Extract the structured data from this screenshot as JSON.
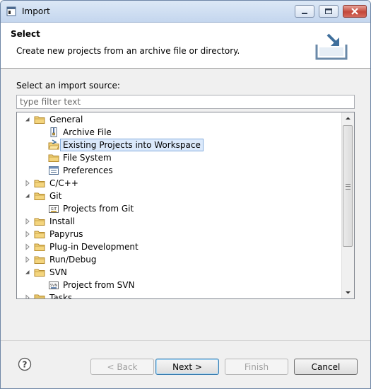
{
  "window": {
    "title": "Import"
  },
  "banner": {
    "title": "Select",
    "description": "Create new projects from an archive file or directory."
  },
  "source": {
    "label": "Select an import source:",
    "filter_placeholder": "type filter text"
  },
  "tree": [
    {
      "label": "General",
      "expanded": true,
      "icon": "folder-icon",
      "depth": 0
    },
    {
      "label": "Archive File",
      "icon": "archive-file-icon",
      "depth": 1
    },
    {
      "label": "Existing Projects into Workspace",
      "icon": "project-folder-icon",
      "depth": 1,
      "selected": true
    },
    {
      "label": "File System",
      "icon": "folder-icon",
      "depth": 1
    },
    {
      "label": "Preferences",
      "icon": "preferences-icon",
      "depth": 1
    },
    {
      "label": "C/C++",
      "expanded": false,
      "icon": "folder-icon",
      "depth": 0
    },
    {
      "label": "Git",
      "expanded": true,
      "icon": "folder-icon",
      "depth": 0
    },
    {
      "label": "Projects from Git",
      "icon": "git-icon",
      "depth": 1
    },
    {
      "label": "Install",
      "expanded": false,
      "icon": "folder-icon",
      "depth": 0
    },
    {
      "label": "Papyrus",
      "expanded": false,
      "icon": "folder-icon",
      "depth": 0
    },
    {
      "label": "Plug-in Development",
      "expanded": false,
      "icon": "folder-icon",
      "depth": 0
    },
    {
      "label": "Run/Debug",
      "expanded": false,
      "icon": "folder-icon",
      "depth": 0
    },
    {
      "label": "SVN",
      "expanded": true,
      "icon": "folder-icon",
      "depth": 0
    },
    {
      "label": "Project from SVN",
      "icon": "svn-icon",
      "depth": 1
    },
    {
      "label": "Tasks",
      "expanded": false,
      "icon": "folder-icon",
      "depth": 0
    }
  ],
  "buttons": {
    "back": "< Back",
    "next": "Next >",
    "finish": "Finish",
    "cancel": "Cancel"
  },
  "colors": {
    "selection_bg": "#dbe9fb",
    "selection_border": "#84acdd",
    "folder": "#e8c25e"
  }
}
